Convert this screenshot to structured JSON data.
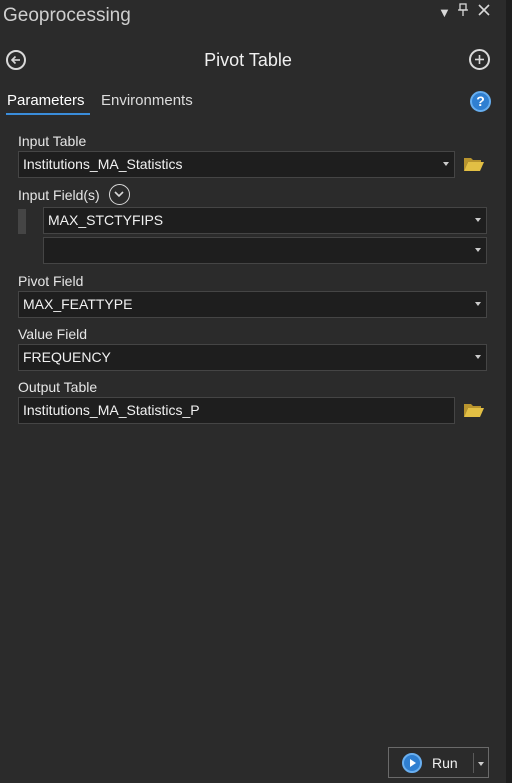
{
  "pane": {
    "title": "Geoprocessing",
    "controls": {
      "dropdown": "▾",
      "pin": "📌",
      "close": "✕"
    }
  },
  "header": {
    "tool_title": "Pivot Table",
    "back_icon": "back-arrow-icon",
    "add_icon": "add-icon"
  },
  "tabs": {
    "parameters": "Parameters",
    "environments": "Environments",
    "help_icon": "?"
  },
  "params": {
    "input_table": {
      "label": "Input Table",
      "value": "Institutions_MA_Statistics"
    },
    "input_fields": {
      "label": "Input Field(s)",
      "values": [
        "MAX_STCTYFIPS",
        ""
      ]
    },
    "pivot_field": {
      "label": "Pivot Field",
      "value": "MAX_FEATTYPE"
    },
    "value_field": {
      "label": "Value Field",
      "value": "FREQUENCY"
    },
    "output_table": {
      "label": "Output Table",
      "value": "Institutions_MA_Statistics_P"
    }
  },
  "footer": {
    "run_label": "Run"
  },
  "colors": {
    "accent": "#3a8ddb",
    "folder": "#d9b43a",
    "background": "#2b2b2b",
    "field_bg": "#1e1e1e"
  }
}
